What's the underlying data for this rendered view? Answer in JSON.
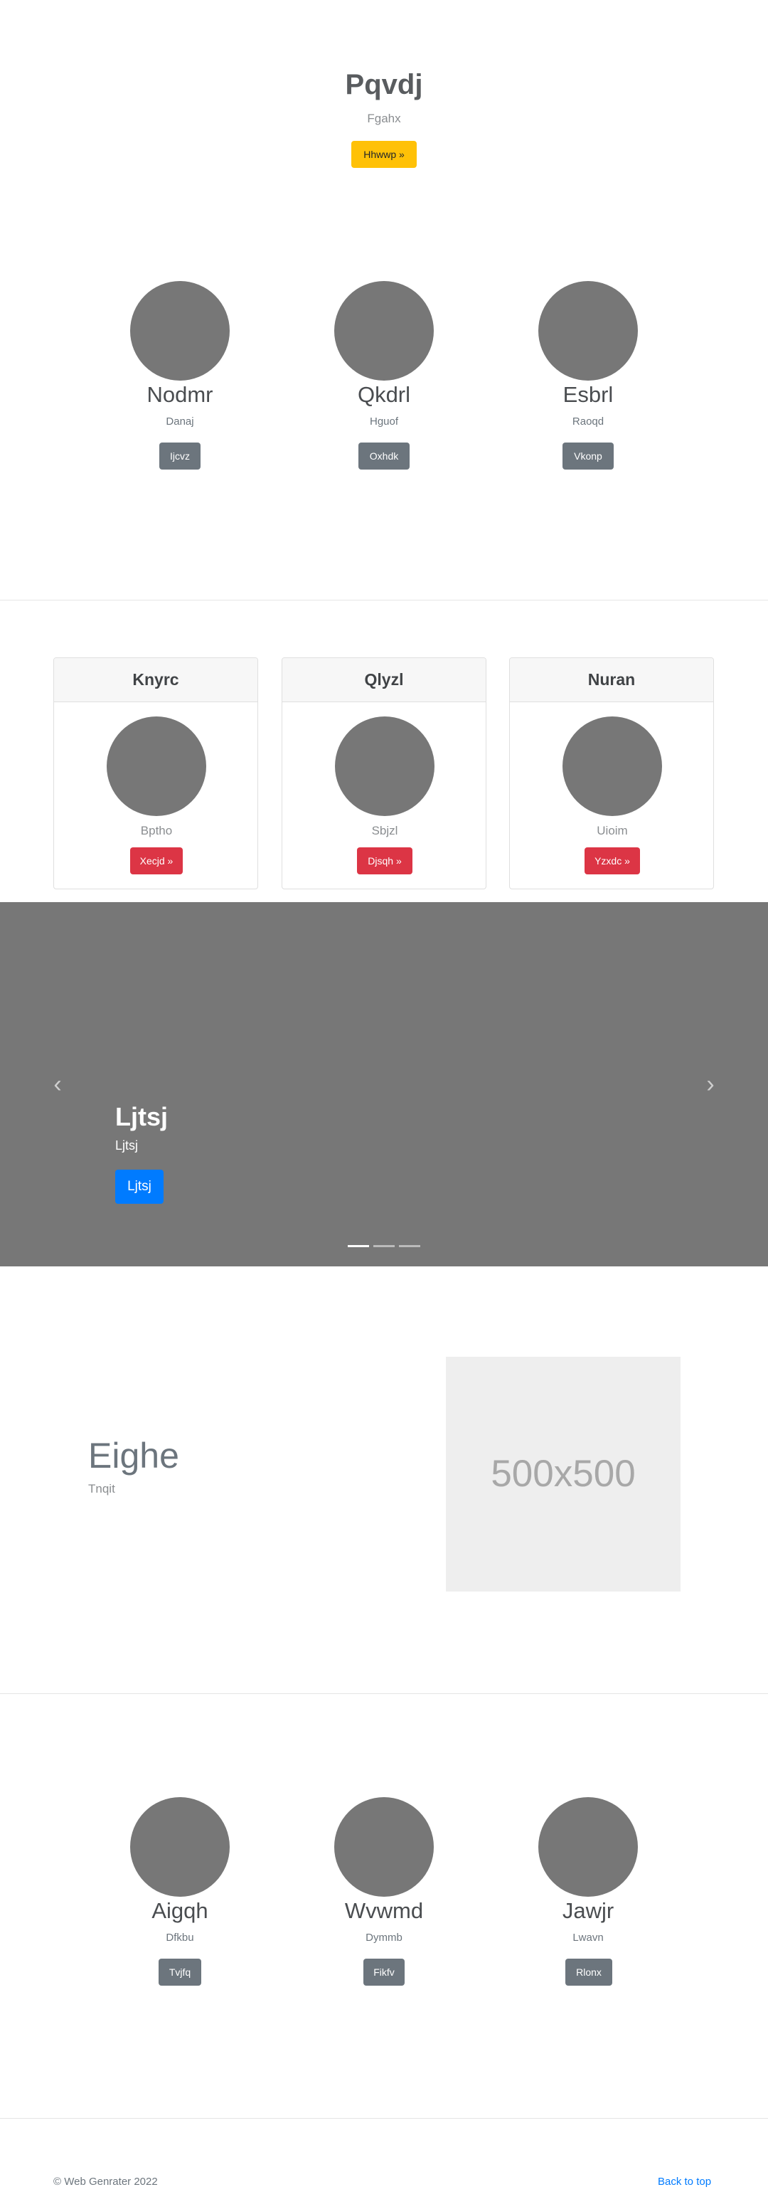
{
  "hero": {
    "title": "Pqvdj",
    "subtitle": "Fgahx",
    "button": "Hhwwp »"
  },
  "team_top": [
    {
      "name": "Nodmr",
      "sub": "Danaj",
      "button": "Ijcvz"
    },
    {
      "name": "Qkdrl",
      "sub": "Hguof",
      "button": "Oxhdk"
    },
    {
      "name": "Esbrl",
      "sub": "Raoqd",
      "button": "Vkonp"
    }
  ],
  "cards": [
    {
      "header": "Knyrc",
      "text": "Bptho",
      "button": "Xecjd »"
    },
    {
      "header": "Qlyzl",
      "text": "Sbjzl",
      "button": "Djsqh »"
    },
    {
      "header": "Nuran",
      "text": "Uioim",
      "button": "Yzxdc »"
    }
  ],
  "carousel": {
    "title": "Ljtsj",
    "subtitle": "Ljtsj",
    "button": "Ljtsj",
    "prev_icon": "chevron-left-icon",
    "next_icon": "chevron-right-icon",
    "prev_glyph": "‹",
    "next_glyph": "›",
    "active_slide": 1,
    "slide_count": 3
  },
  "feature": {
    "title": "Eighe",
    "subtitle": "Tnqit",
    "image_label": "500x500"
  },
  "team_bottom": [
    {
      "name": "Aigqh",
      "sub": "Dfkbu",
      "button": "Tvjfq"
    },
    {
      "name": "Wvwmd",
      "sub": "Dymmb",
      "button": "Fikfv"
    },
    {
      "name": "Jawjr",
      "sub": "Lwavn",
      "button": "Rlonx"
    }
  ],
  "footer": {
    "copyright": "© Web Genrater 2022",
    "back_to_top": "Back to top"
  },
  "colors": {
    "warning": "#ffc107",
    "secondary": "#6c757d",
    "danger": "#dc3545",
    "primary": "#007bff",
    "placeholder_gray": "#777777"
  }
}
